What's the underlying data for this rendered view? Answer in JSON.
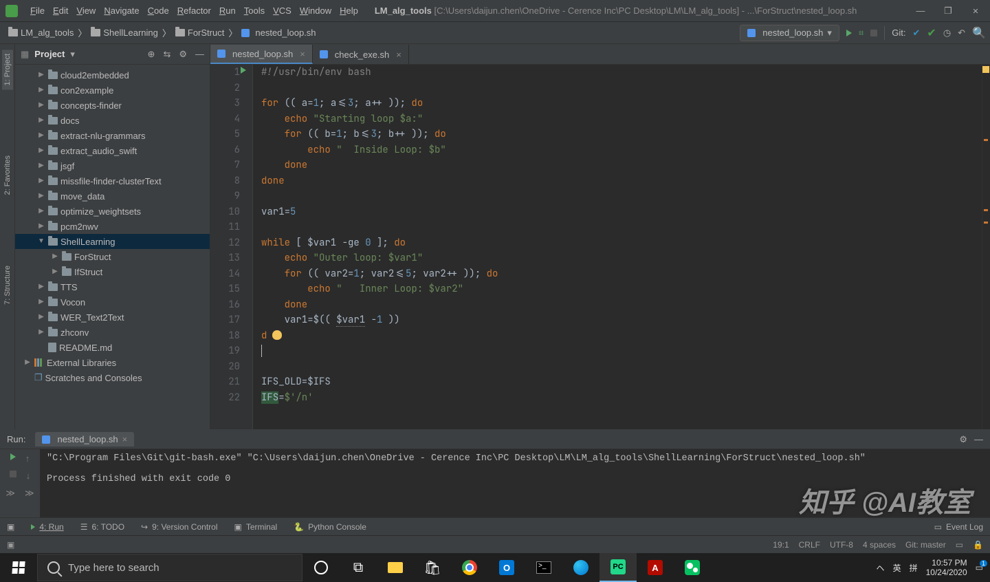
{
  "menu": [
    "File",
    "Edit",
    "View",
    "Navigate",
    "Code",
    "Refactor",
    "Run",
    "Tools",
    "VCS",
    "Window",
    "Help"
  ],
  "title": {
    "project": "LM_alg_tools",
    "path": "[C:\\Users\\daijun.chen\\OneDrive - Cerence Inc\\PC Desktop\\LM\\LM_alg_tools] - ...\\ForStruct\\nested_loop.sh"
  },
  "breadcrumbs": [
    "LM_alg_tools",
    "ShellLearning",
    "ForStruct",
    "nested_loop.sh"
  ],
  "run_config": "nested_loop.sh",
  "git_label": "Git:",
  "project_panel": {
    "label": "Project"
  },
  "tree": [
    {
      "indent": 1,
      "arrow": "r",
      "icon": "folder",
      "label": "cloud2embedded"
    },
    {
      "indent": 1,
      "arrow": "r",
      "icon": "folder",
      "label": "con2example"
    },
    {
      "indent": 1,
      "arrow": "r",
      "icon": "folder",
      "label": "concepts-finder"
    },
    {
      "indent": 1,
      "arrow": "r",
      "icon": "folder",
      "label": "docs"
    },
    {
      "indent": 1,
      "arrow": "r",
      "icon": "folder",
      "label": "extract-nlu-grammars"
    },
    {
      "indent": 1,
      "arrow": "r",
      "icon": "folder",
      "label": "extract_audio_swift"
    },
    {
      "indent": 1,
      "arrow": "r",
      "icon": "folder",
      "label": "jsgf"
    },
    {
      "indent": 1,
      "arrow": "r",
      "icon": "folder",
      "label": "missfile-finder-clusterText"
    },
    {
      "indent": 1,
      "arrow": "r",
      "icon": "folder",
      "label": "move_data"
    },
    {
      "indent": 1,
      "arrow": "r",
      "icon": "folder",
      "label": "optimize_weightsets"
    },
    {
      "indent": 1,
      "arrow": "r",
      "icon": "folder",
      "label": "pcm2nwv"
    },
    {
      "indent": 1,
      "arrow": "d",
      "icon": "folder",
      "label": "ShellLearning",
      "selected": true
    },
    {
      "indent": 2,
      "arrow": "r",
      "icon": "folder",
      "label": "ForStruct"
    },
    {
      "indent": 2,
      "arrow": "r",
      "icon": "folder",
      "label": "IfStruct"
    },
    {
      "indent": 1,
      "arrow": "r",
      "icon": "folder",
      "label": "TTS"
    },
    {
      "indent": 1,
      "arrow": "r",
      "icon": "folder",
      "label": "Vocon"
    },
    {
      "indent": 1,
      "arrow": "r",
      "icon": "folder",
      "label": "WER_Text2Text"
    },
    {
      "indent": 1,
      "arrow": "r",
      "icon": "folder",
      "label": "zhconv"
    },
    {
      "indent": 1,
      "arrow": "",
      "icon": "file",
      "label": "README.md"
    },
    {
      "indent": 0,
      "arrow": "r",
      "icon": "lib",
      "label": "External Libraries"
    },
    {
      "indent": 0,
      "arrow": "",
      "icon": "scratch",
      "label": "Scratches and Consoles"
    }
  ],
  "editor_tabs": [
    {
      "label": "nested_loop.sh",
      "active": true
    },
    {
      "label": "check_exe.sh",
      "active": false
    }
  ],
  "code_lines": [
    {
      "n": 1,
      "html": "<span class='cmt'>#!/usr/bin/env bash</span>"
    },
    {
      "n": 2,
      "html": ""
    },
    {
      "n": 3,
      "html": "<span class='kw'>for</span> (( a=<span class='num'>1</span>; a&lt;=<span class='num'>3</span>; a++ )); <span class='kw'>do</span>"
    },
    {
      "n": 4,
      "html": "    <span class='kw'>echo</span> <span class='str'>\"Starting loop $a:\"</span>"
    },
    {
      "n": 5,
      "html": "    <span class='kw'>for</span> (( b=<span class='num'>1</span>; b&lt;=<span class='num'>3</span>; b++ )); <span class='kw'>do</span>"
    },
    {
      "n": 6,
      "html": "        <span class='kw'>echo</span> <span class='str'>\"  Inside Loop: $b\"</span>"
    },
    {
      "n": 7,
      "html": "    <span class='kw'>done</span>"
    },
    {
      "n": 8,
      "html": "<span class='kw'>done</span>"
    },
    {
      "n": 9,
      "html": ""
    },
    {
      "n": 10,
      "html": "var1=<span class='num'>5</span>"
    },
    {
      "n": 11,
      "html": ""
    },
    {
      "n": 12,
      "html": "<span class='kw'>while</span> [ $var1 -ge <span class='num'>0</span> ]; <span class='kw'>do</span>"
    },
    {
      "n": 13,
      "html": "    <span class='kw'>echo</span> <span class='str'>\"Outer loop: $var1\"</span>"
    },
    {
      "n": 14,
      "html": "    <span class='kw'>for</span> (( var2=<span class='num'>1</span>; var2&lt;=<span class='num'>5</span>; var2++ )); <span class='kw'>do</span>"
    },
    {
      "n": 15,
      "html": "        <span class='kw'>echo</span> <span class='str'>\"   Inner Loop: $var2\"</span>"
    },
    {
      "n": 16,
      "html": "    <span class='kw'>done</span>"
    },
    {
      "n": 17,
      "html": "    var1=$(( <span class='hlvar'>$var1</span> -<span class='num'>1</span> ))"
    },
    {
      "n": 18,
      "html": "<span class='kw'>d</span><span class='bulb' style='position:relative;display:inline-block;top:2px;'></span><span class='kw'>e</span>"
    },
    {
      "n": 19,
      "html": "<span class='caret'></span>"
    },
    {
      "n": 20,
      "html": ""
    },
    {
      "n": 21,
      "html": "IFS_OLD=$IFS"
    },
    {
      "n": 22,
      "html": "<span style='background:#32593d;'>IFS</span>=<span class='str'>$'/n'</span>"
    }
  ],
  "run": {
    "label_prefix": "Run:",
    "tab_label": "nested_loop.sh",
    "console_lines": [
      "\"C:\\Program Files\\Git\\git-bash.exe\" \"C:\\Users\\daijun.chen\\OneDrive - Cerence Inc\\PC Desktop\\LM\\LM_alg_tools\\ShellLearning\\ForStruct\\nested_loop.sh\"",
      "",
      "Process finished with exit code 0"
    ]
  },
  "bottom_tools": [
    "4: Run",
    "6: TODO",
    "9: Version Control",
    "Terminal",
    "Python Console"
  ],
  "status": {
    "pos": "19:1",
    "eol": "CRLF",
    "enc": "UTF-8",
    "indent": "4 spaces",
    "git": "Git: master",
    "eventlog": "Event Log"
  },
  "vtabs_left": [
    "1: Project",
    "2: Favorites",
    "7: Structure"
  ],
  "taskbar": {
    "search_placeholder": "Type here to search"
  },
  "systray": {
    "time": "10:57 PM",
    "date": "10/24/2020",
    "ime1": "英",
    "ime2": "拼",
    "up": "ヘ"
  },
  "watermark": "知乎 @AI教室"
}
